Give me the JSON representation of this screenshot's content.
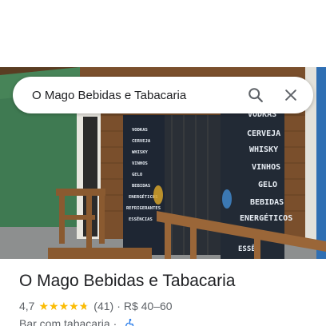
{
  "search": {
    "query": "O Mago Bebidas e Tabacaria"
  },
  "icons": {
    "search": "search-icon",
    "close": "close-icon",
    "accessibility": "wheelchair-icon"
  },
  "photo": {
    "left_door_items": [
      "VODKAS",
      "CERVEJA",
      "WHISKY",
      "VINHOS",
      "GELO",
      "BEBIDAS",
      "ENERGÉTICOS",
      "REFRIGERANTES",
      "ESSÊNCIAS"
    ],
    "right_door_items": [
      "VODKAS",
      "CERVEJA",
      "WHISKY",
      "VINHOS",
      "GELO",
      "BEBIDAS",
      "ENERGÉTICOS"
    ],
    "right_door_bottom": "ESSÊN"
  },
  "place": {
    "name": "O Mago Bebidas e Tabacaria",
    "rating": "4,7",
    "rating_value": 4.7,
    "reviews": "(41)",
    "separator": "·",
    "price": "R$ 40–60",
    "category": "Bar com tabacaria",
    "category_separator": "·"
  },
  "colors": {
    "star": "#fbbc04",
    "text_primary": "#202124",
    "text_secondary": "#5f6368",
    "accessibility_blue": "#1a73e8"
  }
}
